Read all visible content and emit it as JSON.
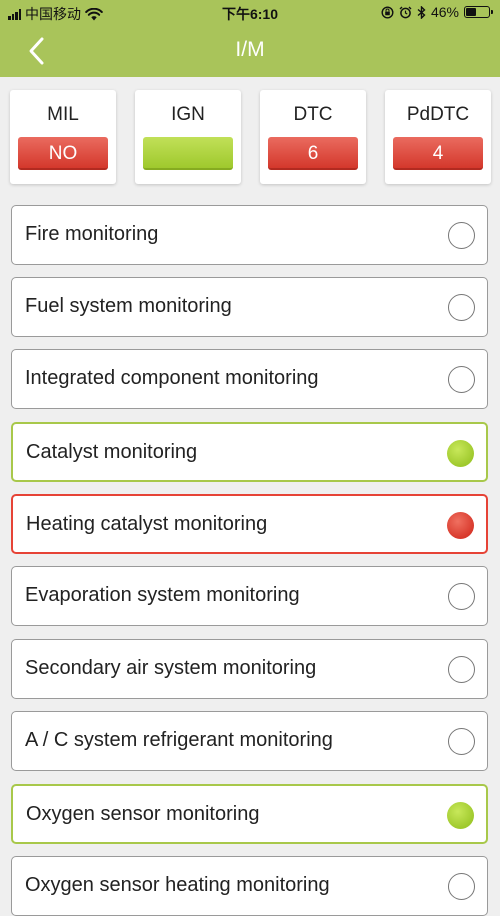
{
  "status_bar": {
    "carrier": "中国移动",
    "time": "下午6:10",
    "battery": "46%",
    "battery_level": 0.46
  },
  "nav": {
    "back_icon": "chevron-left-icon",
    "title": "I/M"
  },
  "cards": [
    {
      "label": "MIL",
      "value": "NO",
      "color": "#e04a3e"
    },
    {
      "label": "IGN",
      "value": "",
      "color": "#a8cf3a"
    },
    {
      "label": "DTC",
      "value": "6",
      "color": "#e04a3e"
    },
    {
      "label": "PdDTC",
      "value": "4",
      "color": "#e04a3e"
    }
  ],
  "items": [
    {
      "label": "Fire monitoring",
      "status": "none"
    },
    {
      "label": "Fuel system monitoring",
      "status": "none"
    },
    {
      "label": "Integrated component monitoring",
      "status": "none"
    },
    {
      "label": "Catalyst monitoring",
      "status": "green"
    },
    {
      "label": "Heating catalyst monitoring",
      "status": "red"
    },
    {
      "label": "Evaporation system monitoring",
      "status": "none"
    },
    {
      "label": "Secondary air system monitoring",
      "status": "none"
    },
    {
      "label": "A / C system refrigerant monitoring",
      "status": "none"
    },
    {
      "label": "Oxygen sensor monitoring",
      "status": "green"
    },
    {
      "label": "Oxygen sensor heating monitoring",
      "status": "none"
    }
  ],
  "colors": {
    "accent": "#a9c45a",
    "green": "#a8c84a",
    "red": "#e64336"
  }
}
